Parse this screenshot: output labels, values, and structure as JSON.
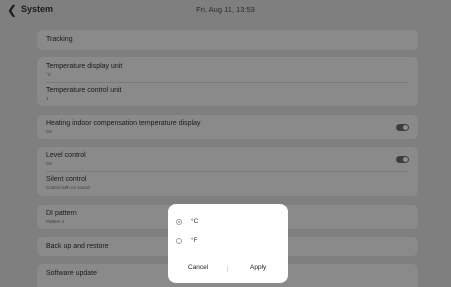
{
  "header": {
    "back_icon": "chevron-left-icon",
    "title": "System",
    "datetime": "Fri, Aug 11, 13:53"
  },
  "settings": {
    "tracking": {
      "title": "Tracking"
    },
    "temp_display_unit": {
      "title": "Temperature display unit",
      "value": "°C"
    },
    "temp_control_unit": {
      "title": "Temperature control unit",
      "value": "1"
    },
    "heating_comp": {
      "title": "Heating indoor compensation temperature display",
      "value": "On",
      "toggle_on": true
    },
    "level_control": {
      "title": "Level control",
      "value": "On",
      "toggle_on": true
    },
    "silent_control": {
      "title": "Silent control",
      "value": "Control with no sound."
    },
    "di_pattern": {
      "title": "DI pattern",
      "value": "Pattern 1"
    },
    "backup_restore": {
      "title": "Back up and restore"
    },
    "software_update": {
      "title": "Software update"
    }
  },
  "dialog": {
    "options": [
      {
        "label": "°C",
        "selected": true
      },
      {
        "label": "°F",
        "selected": false
      }
    ],
    "cancel_label": "Cancel",
    "apply_label": "Apply"
  }
}
